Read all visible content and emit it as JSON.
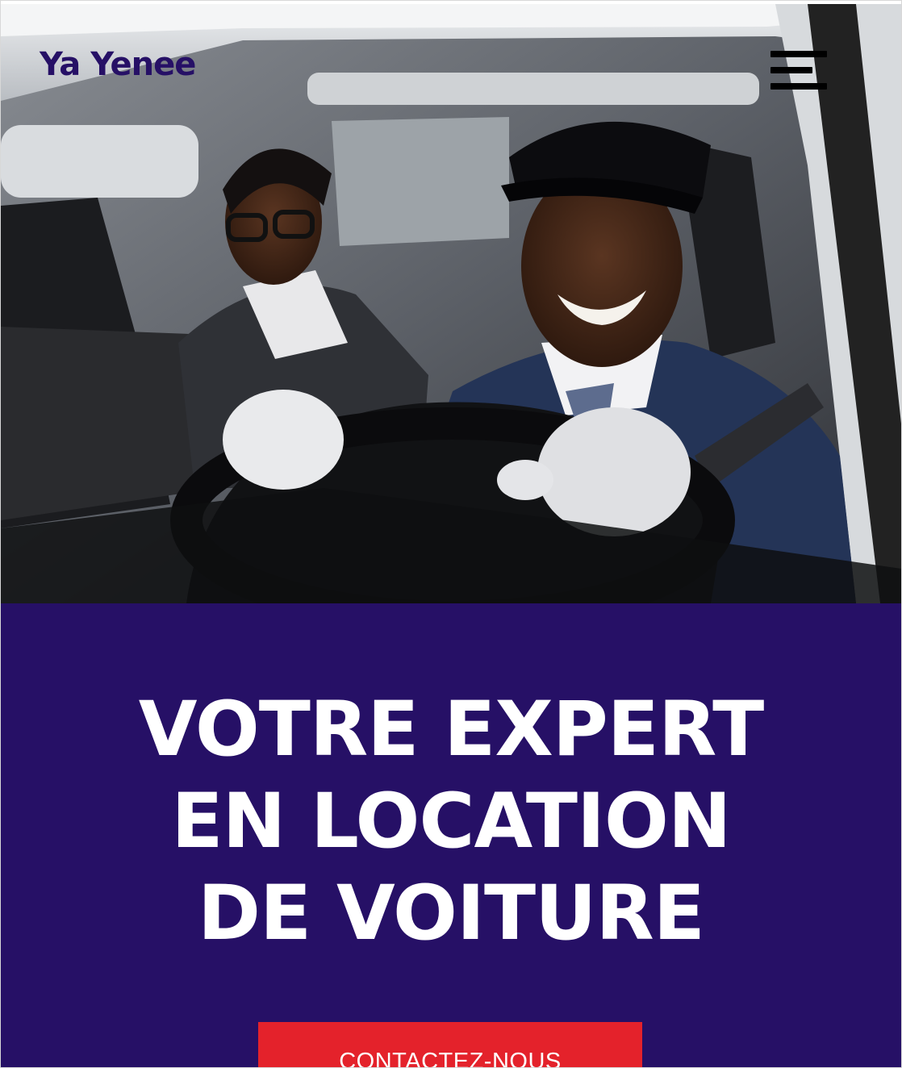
{
  "header": {
    "brand": "Ya Yenee",
    "menu_icon": "hamburger-menu-icon"
  },
  "hero": {
    "image_subject": "chauffeur-with-passenger-photo"
  },
  "main": {
    "headline_lines": [
      "VOTRE EXPERT",
      "EN LOCATION",
      "DE VOITURE"
    ],
    "cta_label": "CONTACTEZ-NOUS"
  },
  "colors": {
    "brand": "#261066",
    "section_bg": "#261066",
    "cta_bg": "#e4222b",
    "text_light": "#ffffff"
  }
}
